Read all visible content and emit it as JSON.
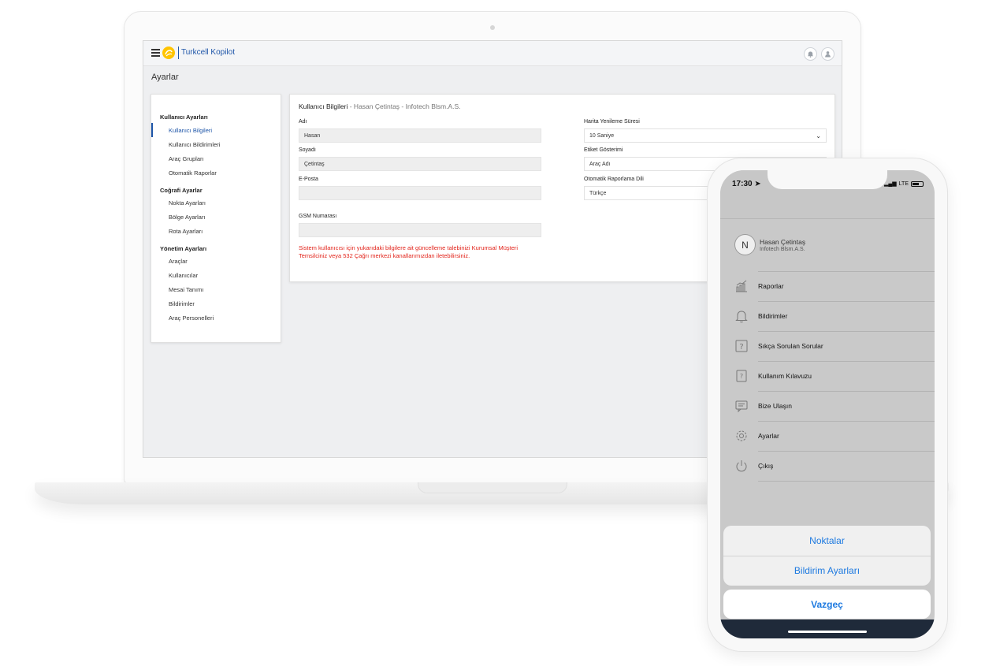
{
  "app": {
    "name": "Turkcell Kopilot"
  },
  "page": {
    "title": "Ayarlar"
  },
  "settings_menu": {
    "groups": [
      {
        "title": "Kullanıcı Ayarları",
        "items": [
          "Kullanıcı Bilgileri",
          "Kullanıcı Bildirimleri",
          "Araç Grupları",
          "Otomatik Raporlar"
        ]
      },
      {
        "title": "Coğrafi Ayarlar",
        "items": [
          "Nokta Ayarları",
          "Bölge Ayarları",
          "Rota Ayarları"
        ]
      },
      {
        "title": "Yönetim Ayarları",
        "items": [
          "Araçlar",
          "Kullanıcılar",
          "Mesai Tanımı",
          "Bildirimler",
          "Araç Personelleri"
        ]
      }
    ],
    "active_item": "Kullanıcı Bilgileri"
  },
  "user_info": {
    "title": "Kullanıcı Bilgileri",
    "subtitle": " - Hasan Çetintaş - Infotech Blsm.A.S.",
    "fields": {
      "first_name": {
        "label": "Adı",
        "value": "Hasan"
      },
      "last_name": {
        "label": "Soyadı",
        "value": "Çetintaş"
      },
      "email": {
        "label": "E-Posta",
        "value": ""
      },
      "gsm": {
        "label": "GSM Numarası",
        "value": ""
      },
      "map_refresh": {
        "label": "Harita Yenileme Süresi",
        "value": "10 Saniye"
      },
      "tag_display": {
        "label": "Etiket Gösterimi",
        "value": "Araç Adı"
      },
      "report_language": {
        "label": "Otomatik Raporlama Dili",
        "value": "Türkçe"
      }
    },
    "warning": "Sistem kullanıcısı için yukarıdaki bilgilere ait güncelleme talebinizi Kurumsal Müşteri Temsilciniz veya 532 Çağrı merkezi kanallarımızdan iletebilirsiniz."
  },
  "phone": {
    "status": {
      "time": "17:30",
      "network": "LTE"
    },
    "profile": {
      "initial": "N",
      "name": "Hasan Çetintaş",
      "company": "Infotech Blsm.A.S."
    },
    "menu": [
      {
        "label": "Raporlar",
        "icon": "chart-icon"
      },
      {
        "label": "Bildirimler",
        "icon": "bell-icon"
      },
      {
        "label": "Sıkça Sorulan Sorular",
        "icon": "question-icon"
      },
      {
        "label": "Kullanım Kılavuzu",
        "icon": "guide-icon"
      },
      {
        "label": "Bize Ulaşın",
        "icon": "chat-icon"
      },
      {
        "label": "Ayarlar",
        "icon": "gear-icon"
      },
      {
        "label": "Çıkış",
        "icon": "power-icon"
      }
    ],
    "action_sheet": {
      "options": [
        "Noktalar",
        "Bildirim Ayarları"
      ],
      "cancel": "Vazgeç"
    }
  },
  "colors": {
    "brand_blue": "#1e55a8",
    "brand_yellow": "#ffc400",
    "warning_red": "#e2231a",
    "ios_blue": "#1e7ae0"
  }
}
